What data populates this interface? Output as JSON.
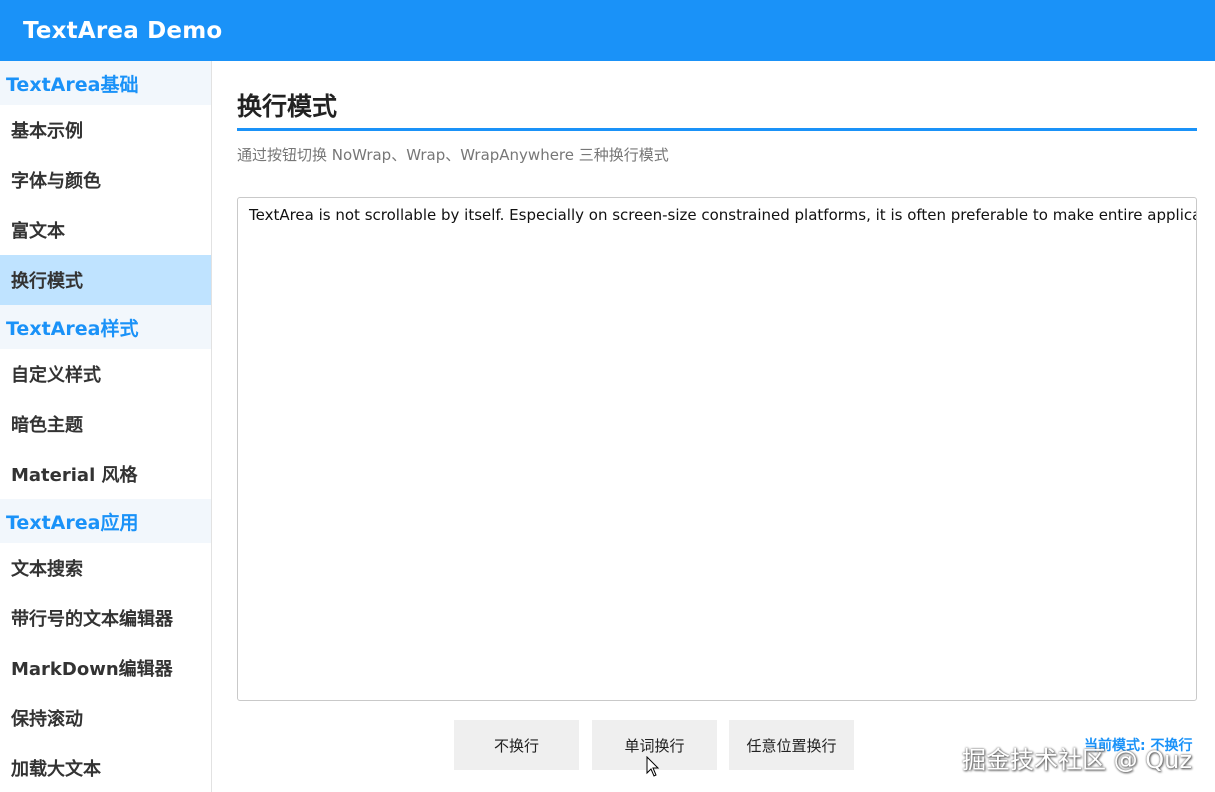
{
  "app": {
    "title": "TextArea Demo"
  },
  "sidebar": {
    "groups": [
      {
        "label": "TextArea基础",
        "items": [
          {
            "label": "基本示例"
          },
          {
            "label": "字体与颜色"
          },
          {
            "label": "富文本"
          },
          {
            "label": "换行模式",
            "active": true
          }
        ]
      },
      {
        "label": "TextArea样式",
        "items": [
          {
            "label": "自定义样式"
          },
          {
            "label": "暗色主题"
          },
          {
            "label": "Material 风格"
          }
        ]
      },
      {
        "label": "TextArea应用",
        "items": [
          {
            "label": "文本搜索"
          },
          {
            "label": "带行号的文本编辑器"
          },
          {
            "label": "MarkDown编辑器"
          },
          {
            "label": "保持滚动"
          },
          {
            "label": "加载大文本"
          }
        ]
      }
    ]
  },
  "main": {
    "title": "换行模式",
    "description": "通过按钮切换 NoWrap、Wrap、WrapAnywhere 三种换行模式",
    "textarea_value": "TextArea is not scrollable by itself. Especially on screen-size constrained platforms, it is often preferable to make entire application pa",
    "buttons": {
      "nowrap": "不换行",
      "word_wrap": "单词换行",
      "anywhere": "任意位置换行"
    },
    "current_mode": "当前模式: 不换行"
  },
  "watermark": "掘金技术社区 @ Quz",
  "colors": {
    "accent": "#1a92f8",
    "active_item": "#bfe3ff",
    "group_bg": "#f2f7fc"
  }
}
